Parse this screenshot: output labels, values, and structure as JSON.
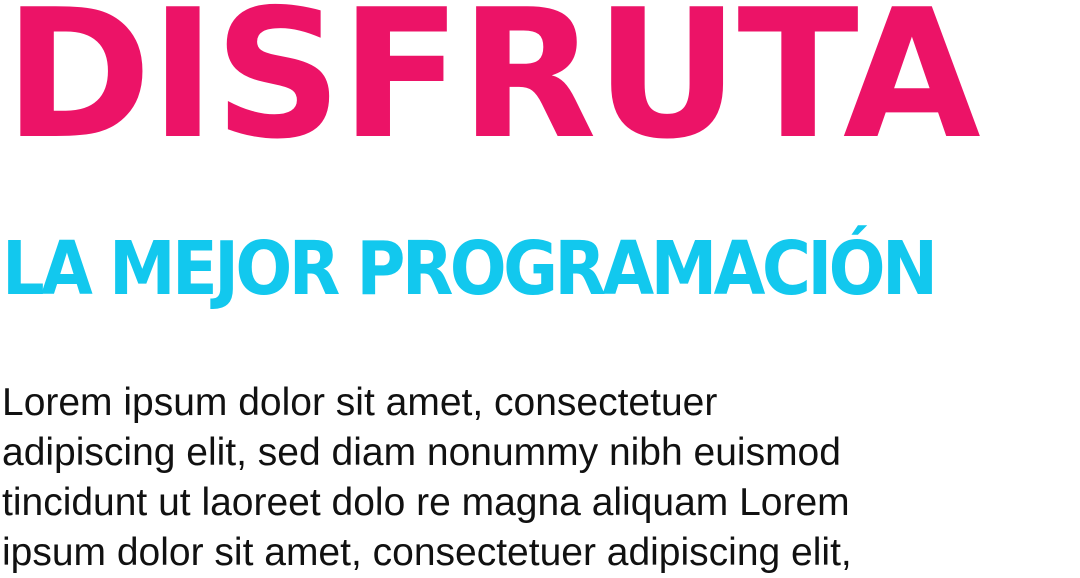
{
  "headline": {
    "text": "DISFRUTA",
    "color": "#ec1367"
  },
  "subhead": {
    "text": "LA MEJOR PROGRAMACIÓN",
    "color": "#12c8ee"
  },
  "body": {
    "lines": [
      "Lorem ipsum dolor sit amet, consectetuer",
      "adipiscing elit, sed diam nonummy nibh euismod",
      "tincidunt ut laoreet dolo re magna aliquam  Lorem",
      "ipsum dolor sit amet, consectetuer adipiscing elit,"
    ]
  }
}
